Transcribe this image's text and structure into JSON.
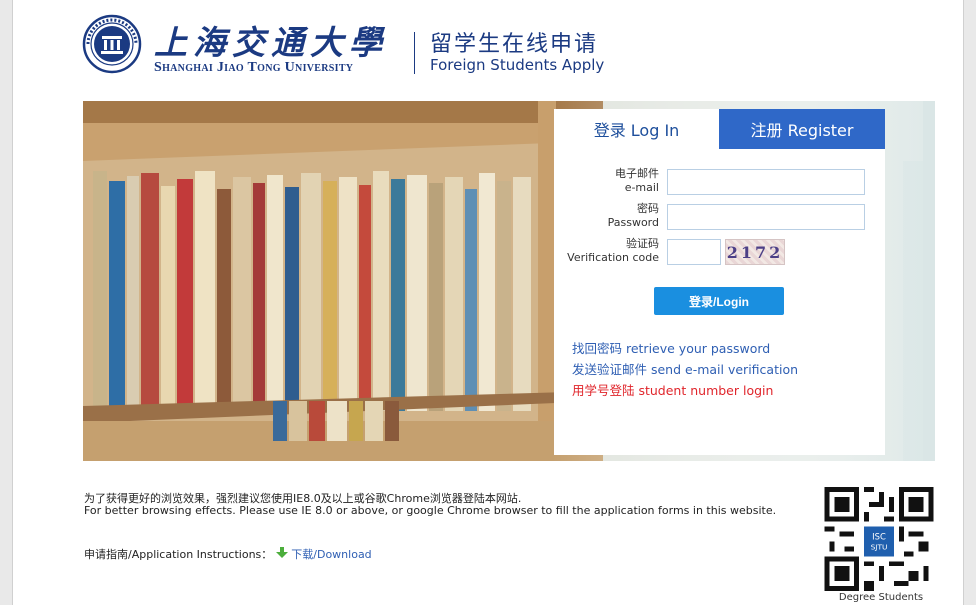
{
  "header": {
    "university_cn": "上海交通大學",
    "university_en": "Shanghai Jiao Tong University",
    "system_cn": "留学生在线申请",
    "system_en": "Foreign Students Apply"
  },
  "tabs": {
    "login": "登录 Log In",
    "register": "注册 Register"
  },
  "form": {
    "email_label_cn": "电子邮件",
    "email_label_en": "e-mail",
    "email_value": "",
    "password_label_cn": "密码",
    "password_label_en": "Password",
    "password_value": "",
    "verify_label_cn": "验证码",
    "verify_label_en": "Verification code",
    "verify_value": "",
    "captcha_text": "2172",
    "login_button": "登录/Login"
  },
  "links": {
    "retrieve_password": "找回密码 retrieve your password",
    "send_verification": "发送验证邮件 send e-mail verification",
    "student_number_login": "用学号登陆 student number login"
  },
  "footer": {
    "browser_note_cn": "为了获得更好的浏览效果，强烈建议您使用IE8.0及以上或谷歌Chrome浏览器登陆本网站.",
    "browser_note_en": "For better browsing effects. Please use IE 8.0 or above, or google Chrome browser to fill the application forms in this website.",
    "instructions_label": "申请指南/Application Instructions：",
    "download_link": "下载/Download",
    "qr_caption": "Degree Students",
    "qr_badge": "ISC SJTU"
  },
  "colors": {
    "brand_navy": "#1b3a82",
    "tab_blue": "#2f68c8",
    "button_blue": "#1a8fe0",
    "link_blue": "#2f5fb3",
    "link_red": "#e0252b"
  },
  "icons": {
    "seal": "university-seal-icon",
    "download": "download-arrow-icon",
    "qr": "qr-code-icon"
  }
}
